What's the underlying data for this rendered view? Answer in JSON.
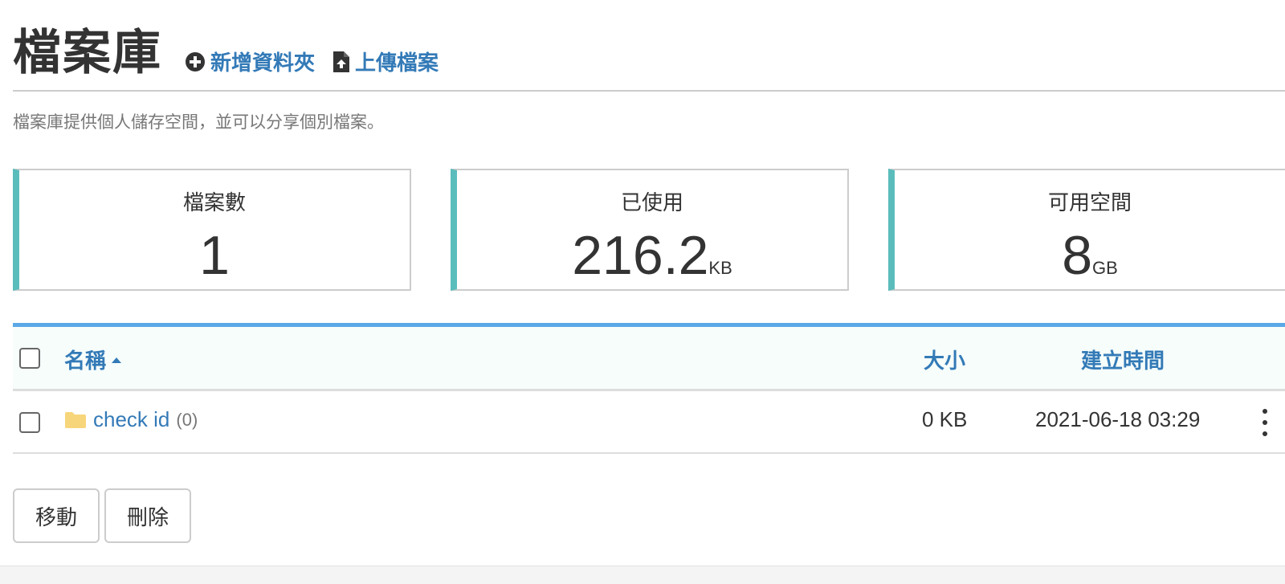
{
  "header": {
    "title": "檔案庫",
    "actions": {
      "new_folder": "新增資料夾",
      "upload": "上傳檔案"
    }
  },
  "description": "檔案庫提供個人儲存空間，並可以分享個別檔案。",
  "stats": [
    {
      "label": "檔案數",
      "value": "1",
      "unit": ""
    },
    {
      "label": "已使用",
      "value": "216.2",
      "unit": "KB"
    },
    {
      "label": "可用空間",
      "value": "8",
      "unit": "GB"
    }
  ],
  "table": {
    "columns": {
      "name": "名稱",
      "size": "大小",
      "created": "建立時間"
    },
    "rows": [
      {
        "name": "check id",
        "count": "(0)",
        "size": "0 KB",
        "created": "2021-06-18 03:29"
      }
    ]
  },
  "buttons": {
    "move": "移動",
    "delete": "刪除"
  },
  "colors": {
    "accent": "#337ab7",
    "card_border": "#5bbcbc",
    "table_top": "#5aa8e6",
    "folder": "#f7d57a"
  }
}
